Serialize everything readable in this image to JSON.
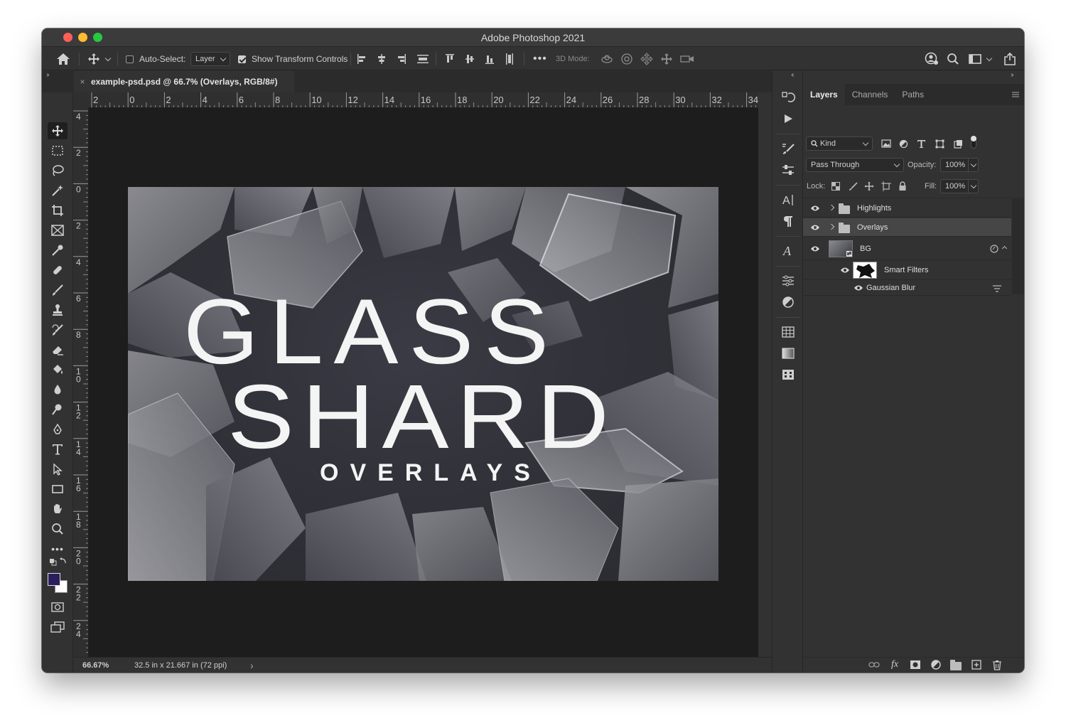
{
  "window": {
    "title": "Adobe Photoshop 2021"
  },
  "options_bar": {
    "auto_select_label": "Auto-Select:",
    "auto_select_checked": false,
    "auto_select_target": "Layer",
    "show_transform_label": "Show Transform Controls",
    "show_transform_checked": true,
    "three_d_label": "3D Mode:"
  },
  "document": {
    "tab_title": "example-psd.psd @ 66.7% (Overlays, RGB/8#)",
    "close_symbol": "×"
  },
  "rulers": {
    "horizontal": [
      "2",
      "0",
      "2",
      "4",
      "6",
      "8",
      "10",
      "12",
      "14",
      "16",
      "18",
      "20",
      "22",
      "24",
      "26",
      "28",
      "30",
      "32",
      "34"
    ],
    "vertical": [
      "4",
      "2",
      "0",
      "2",
      "4",
      "6",
      "8",
      "10",
      "12",
      "14",
      "16",
      "18",
      "20",
      "22",
      "24"
    ]
  },
  "canvas": {
    "line1": "GLASS",
    "line2": "SHARD",
    "line3": "OVERLAYS"
  },
  "status_bar": {
    "zoom": "66.67%",
    "doc_info": "32.5 in x 21.667 in (72 ppi)",
    "more_symbol": "›"
  },
  "layers_panel": {
    "tabs": [
      {
        "label": "Layers",
        "active": true
      },
      {
        "label": "Channels",
        "active": false
      },
      {
        "label": "Paths",
        "active": false
      }
    ],
    "filter_kind": "Kind",
    "blend_mode": "Pass Through",
    "opacity_label": "Opacity:",
    "opacity_value": "100%",
    "lock_label": "Lock:",
    "fill_label": "Fill:",
    "fill_value": "100%",
    "layers": [
      {
        "name": "Highlights",
        "type": "group",
        "selected": false
      },
      {
        "name": "Overlays",
        "type": "group",
        "selected": true
      },
      {
        "name": "BG",
        "type": "smart-object",
        "selected": false
      },
      {
        "name": "Smart Filters",
        "type": "smart-filters",
        "selected": false
      },
      {
        "name": "Gaussian Blur",
        "type": "filter",
        "selected": false
      }
    ]
  },
  "colors": {
    "foreground": "#2a1f5c",
    "background": "#ffffff",
    "ui_dark": "#323232",
    "canvas_bg": "#1d1d1d"
  }
}
